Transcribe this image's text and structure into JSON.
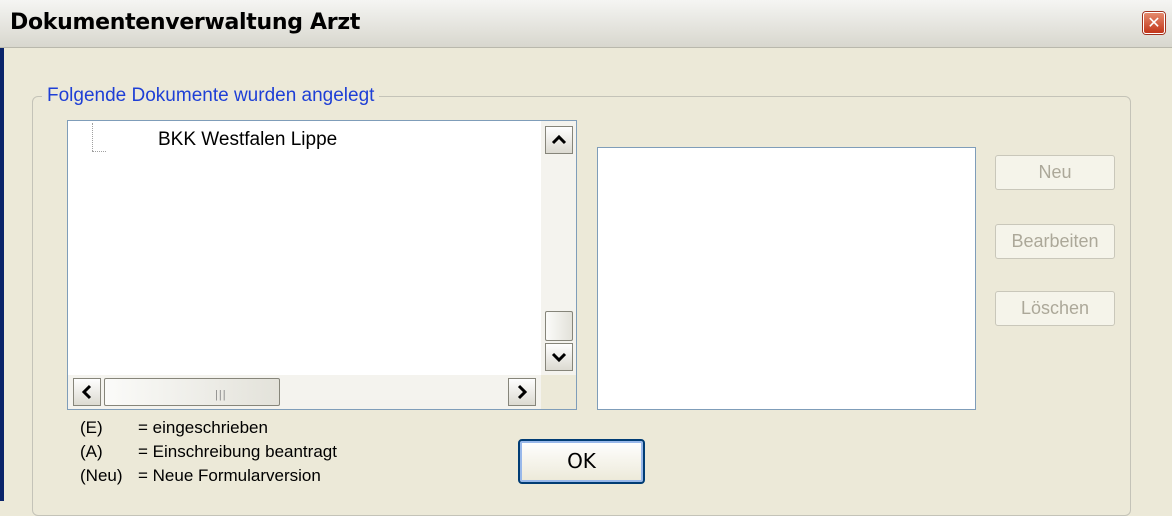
{
  "window": {
    "title": "Dokumentenverwaltung Arzt",
    "close_glyph": "✕"
  },
  "group": {
    "legend": "Folgende Dokumente wurden angelegt"
  },
  "tree": {
    "items": [
      {
        "label": "BKK Westfalen Lippe"
      }
    ]
  },
  "buttons": {
    "new": "Neu",
    "edit": "Bearbeiten",
    "delete": "Löschen",
    "ok": "OK"
  },
  "legend": [
    {
      "key": "(E)",
      "text": "= eingeschrieben"
    },
    {
      "key": "(A)",
      "text": "= Einschreibung beantragt"
    },
    {
      "key": "(Neu)",
      "text": "= Neue Formularversion"
    }
  ],
  "icons": {
    "scroll_up": "chevron-up-icon",
    "scroll_down": "chevron-down-icon",
    "scroll_left": "chevron-left-icon",
    "scroll_right": "chevron-right-icon"
  },
  "colors": {
    "group_legend": "#1e3fd6",
    "disabled_text": "#aca899",
    "window_bg": "#ece9d8"
  }
}
